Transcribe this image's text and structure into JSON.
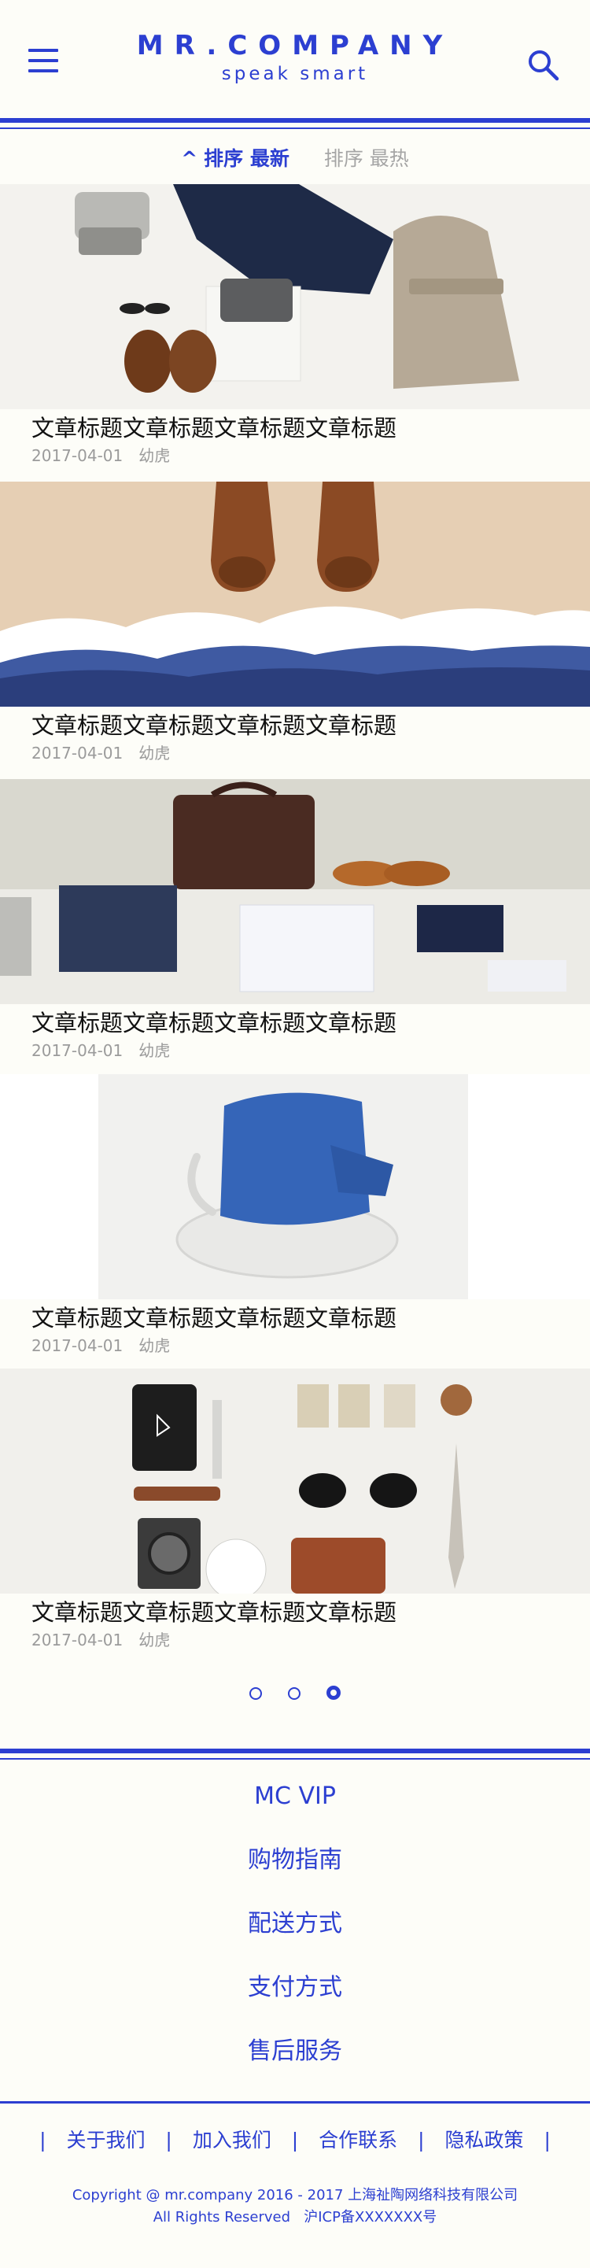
{
  "brand": {
    "name": "MR.COMPANY",
    "tagline": "speak smart",
    "color": "#2c3fd1"
  },
  "header": {
    "menu_icon": "hamburger-menu-icon",
    "search_icon": "search-icon"
  },
  "sort": {
    "active_label": "排序 最新",
    "inactive_label": "排序 最热",
    "active_icon": "chevron-up-icon"
  },
  "articles": [
    {
      "title": "文章标题文章标题文章标题文章标题",
      "date": "2017-04-01",
      "author": "幼虎"
    },
    {
      "title": "文章标题文章标题文章标题文章标题",
      "date": "2017-04-01",
      "author": "幼虎"
    },
    {
      "title": "文章标题文章标题文章标题文章标题",
      "date": "2017-04-01",
      "author": "幼虎"
    },
    {
      "title": "文章标题文章标题文章标题文章标题",
      "date": "2017-04-01",
      "author": "幼虎"
    },
    {
      "title": "文章标题文章标题文章标题文章标题",
      "date": "2017-04-01",
      "author": "幼虎"
    }
  ],
  "pagination": {
    "pages": 3,
    "current": 3
  },
  "footer_menu": [
    "MC VIP",
    "购物指南",
    "配送方式",
    "支付方式",
    "售后服务"
  ],
  "footer_links": [
    "关于我们",
    "加入我们",
    "合作联系",
    "隐私政策"
  ],
  "copyright": {
    "line1": "Copyright @ mr.company 2016 - 2017 上海祉陶网络科技有限公司",
    "line2": "All Rights Reserved   沪ICP备XXXXXXX号"
  }
}
